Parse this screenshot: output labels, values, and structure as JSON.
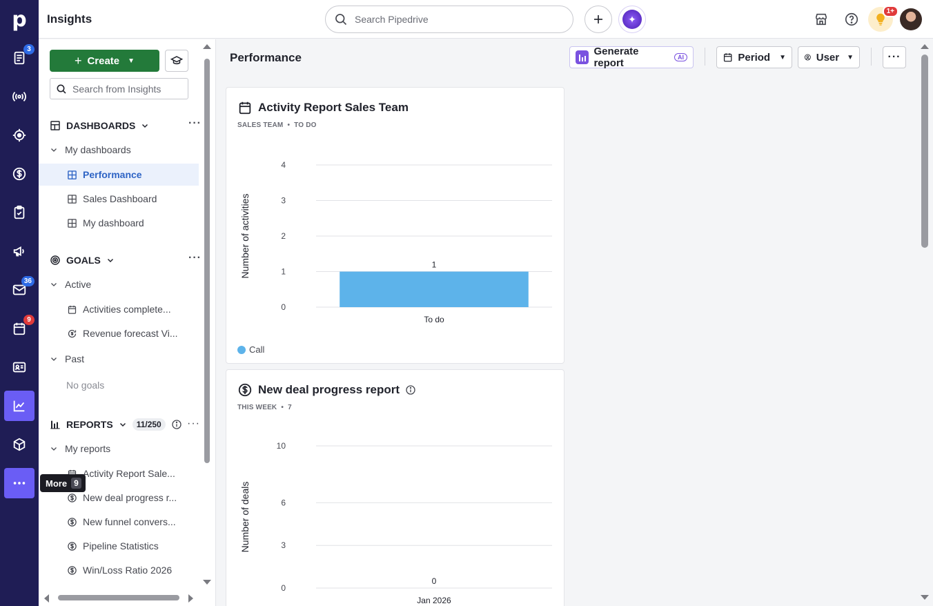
{
  "app": {
    "title": "Insights",
    "search_placeholder": "Search Pipedrive"
  },
  "rail": {
    "logo": "p",
    "items": [
      {
        "icon": "leads-icon",
        "badge": "3",
        "badge_color": "blue"
      },
      {
        "icon": "broadcast-icon"
      },
      {
        "icon": "target-icon"
      },
      {
        "icon": "dollar-icon"
      },
      {
        "icon": "clipboard-check-icon"
      },
      {
        "icon": "megaphone-icon"
      },
      {
        "icon": "mail-icon",
        "badge": "36",
        "badge_color": "blue"
      },
      {
        "icon": "calendar-icon",
        "badge": "9",
        "badge_color": "red"
      },
      {
        "icon": "contacts-icon"
      },
      {
        "icon": "insights-chart-icon",
        "active": true
      },
      {
        "icon": "box-icon"
      },
      {
        "icon": "more-icon"
      }
    ],
    "tooltip": {
      "label": "More",
      "shortcut": "9"
    }
  },
  "topbar": {
    "notification_badge": "1+"
  },
  "sidebar": {
    "create_label": "Create",
    "search_placeholder": "Search from Insights",
    "dashboards": {
      "heading": "DASHBOARDS",
      "group": "My dashboards",
      "items": [
        "Performance",
        "Sales Dashboard",
        "My dashboard"
      ],
      "active": "Performance"
    },
    "goals": {
      "heading": "GOALS",
      "active_group": "Active",
      "active_items": [
        "Activities complete...",
        "Revenue forecast Vi..."
      ],
      "past_group": "Past",
      "past_empty": "No goals"
    },
    "reports": {
      "heading": "REPORTS",
      "count": "11/250",
      "group": "My reports",
      "items": [
        "Activity Report Sale...",
        "New deal progress r...",
        "New funnel convers...",
        "Pipeline Statistics",
        "Win/Loss Ratio 2026"
      ]
    }
  },
  "main": {
    "title": "Performance",
    "generate_label": "Generate report",
    "ai_label": "AI",
    "period_label": "Period",
    "user_label": "User"
  },
  "cards": [
    {
      "title": "Activity Report Sales Team",
      "meta": [
        "SALES TEAM",
        "TO DO"
      ],
      "legend": "Call",
      "legend_color": "#5db3ea"
    },
    {
      "title": "New deal progress report",
      "meta": [
        "THIS WEEK",
        "7"
      ]
    }
  ],
  "chart_data": [
    {
      "type": "bar",
      "title": "Activity Report Sales Team",
      "categories": [
        "To do"
      ],
      "series": [
        {
          "name": "Call",
          "values": [
            1
          ],
          "color": "#5db3ea"
        }
      ],
      "ylabel": "Number of activities",
      "yticks": [
        "0",
        "1",
        "2",
        "3",
        "4"
      ],
      "ylim": [
        0,
        4
      ],
      "data_labels": [
        "1"
      ],
      "grid": true
    },
    {
      "type": "bar",
      "title": "New deal progress report",
      "categories": [
        "Jan 2026"
      ],
      "values": [
        0
      ],
      "ylabel": "Number of deals",
      "yticks": [
        "0",
        "3",
        "6",
        "10"
      ],
      "ylim": [
        0,
        10
      ],
      "data_labels": [
        "0"
      ],
      "grid": true
    }
  ]
}
